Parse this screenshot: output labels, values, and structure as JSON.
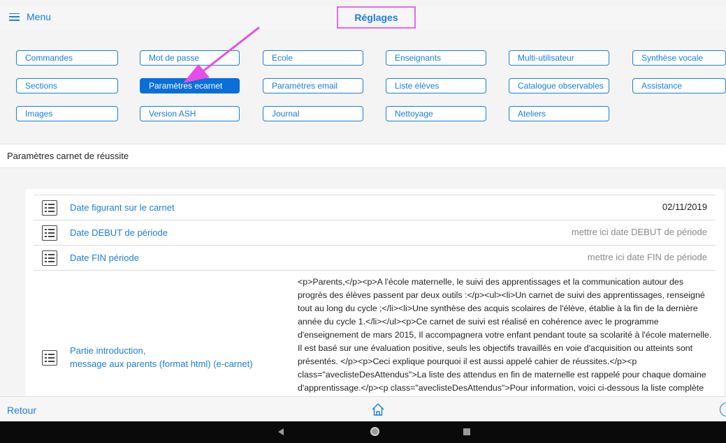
{
  "topbar": {
    "menu_label": "Menu",
    "title": "Réglages",
    "highlight_color": "#e66ae6"
  },
  "settings_buttons": [
    {
      "label": "Commandes"
    },
    {
      "label": "Mot de passe"
    },
    {
      "label": "Ecole"
    },
    {
      "label": "Enseignants"
    },
    {
      "label": "Multi-utilisateur"
    },
    {
      "label": "Synthèse vocale"
    },
    {
      "label": "Sections"
    },
    {
      "label": "Paramètres ecarnet",
      "selected": true
    },
    {
      "label": "Paramètres email"
    },
    {
      "label": "Liste élèves"
    },
    {
      "label": "Catalogue observables"
    },
    {
      "label": "Assistance"
    },
    {
      "label": "Images"
    },
    {
      "label": "Version ASH"
    },
    {
      "label": "Journal"
    },
    {
      "label": "Nettoyage"
    },
    {
      "label": "Ateliers"
    }
  ],
  "section": {
    "title": "Paramètres carnet de réussite"
  },
  "rows": [
    {
      "icon": "list-icon",
      "label": "Date figurant sur le carnet",
      "value": "02/11/2019",
      "is_placeholder": false
    },
    {
      "icon": "list-icon",
      "label": "Date DEBUT de période",
      "value": "mettre ici date DEBUT de  période",
      "is_placeholder": true
    },
    {
      "icon": "list-icon",
      "label": "Date FIN période",
      "value": "mettre ici date FIN de période",
      "is_placeholder": true
    },
    {
      "icon": "list-icon",
      "label_line1": "Partie introduction,",
      "label_line2": "message aux parents (format html) (e-carnet)",
      "value": "<p>Parents,</p><p>A l'école maternelle, le suivi des apprentissages et la communication autour des progrès des élèves passent par deux outils :</p><ul><li>Un carnet de suivi des apprentissages, renseigné tout au long du cycle ;</li><li>Une synthèse des acquis scolaires de l'élève, établie à la fin de la dernière année du cycle 1.</li></ul><p>Ce carnet de suivi est réalisé en cohérence avec le programme d'enseignement de mars 2015, Il accompagnera votre enfant pendant toute sa scolarité à l'école maternelle. Il est basé sur une évaluation positive, seuls les objectifs travaillés en voie d'acquisition ou atteints sont présentés. </p><p>Ceci explique pourquoi il est aussi appelé cahier de réussites.</p><p class=\"aveclisteDesAttendus\">La liste des attendus en fin de maternelle est rappelé pour chaque domaine d'apprentissage.</p><p class=\"aveclisteDesAttendus\">Pour information, voici ci-dessous la liste complète des"
    }
  ],
  "bottombar": {
    "back_label": "Retour",
    "home_icon": "home-icon",
    "help_icon": "help-icon"
  },
  "colors": {
    "accent": "#1a7ee0",
    "selected_button": "#0a6fd6",
    "annotation_arrow": "#e64de6"
  }
}
